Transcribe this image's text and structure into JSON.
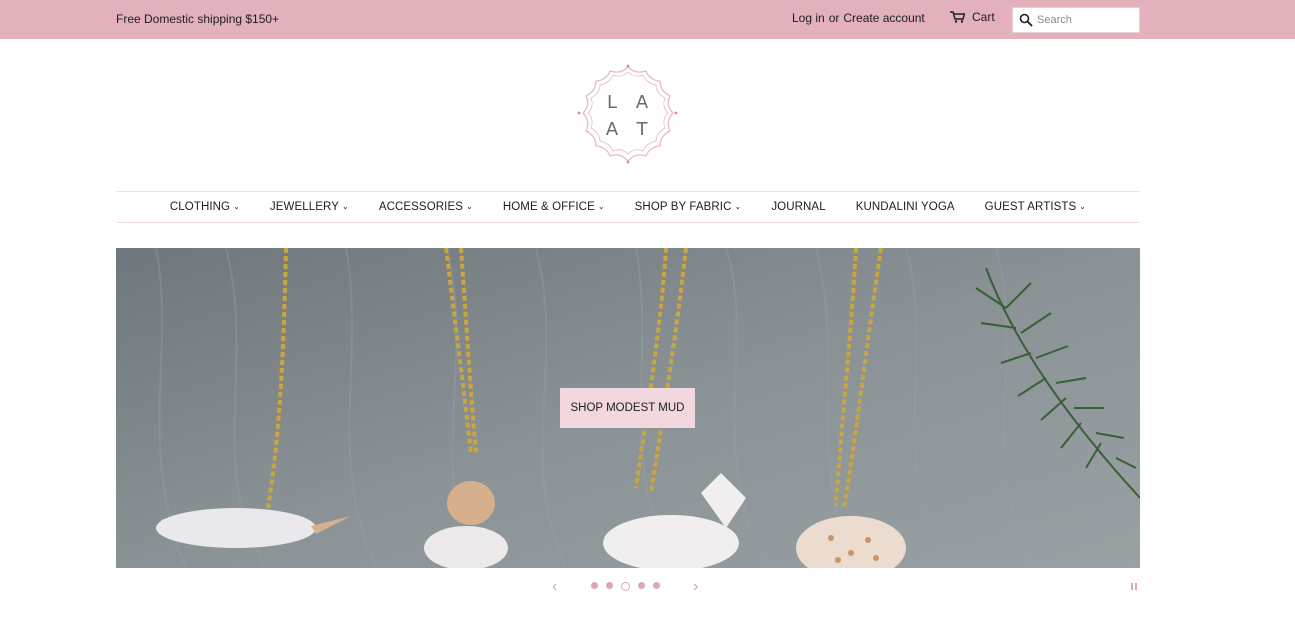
{
  "topbar": {
    "shipping_text": "Free Domestic shipping $150+",
    "login_label": "Log in",
    "or_text": "or",
    "create_account_label": "Create account",
    "cart_label": "Cart",
    "search_placeholder": "Search",
    "background_color": "#e2b1bc"
  },
  "logo": {
    "letters": [
      "L",
      "A",
      "A",
      "T"
    ]
  },
  "nav": {
    "items": [
      {
        "label": "CLOTHING",
        "dropdown": true
      },
      {
        "label": "JEWELLERY",
        "dropdown": true
      },
      {
        "label": "ACCESSORIES",
        "dropdown": true
      },
      {
        "label": "HOME & OFFICE",
        "dropdown": true
      },
      {
        "label": "SHOP BY FABRIC",
        "dropdown": true
      },
      {
        "label": "JOURNAL",
        "dropdown": false
      },
      {
        "label": "KUNDALINI YOGA",
        "dropdown": false
      },
      {
        "label": "GUEST ARTISTS",
        "dropdown": true
      }
    ],
    "chevron": "⌄"
  },
  "hero": {
    "button_label": "SHOP MODEST MUD"
  },
  "slideshow": {
    "prev_icon": "‹",
    "next_icon": "›",
    "slide_count": 5,
    "active_slide": 3
  }
}
